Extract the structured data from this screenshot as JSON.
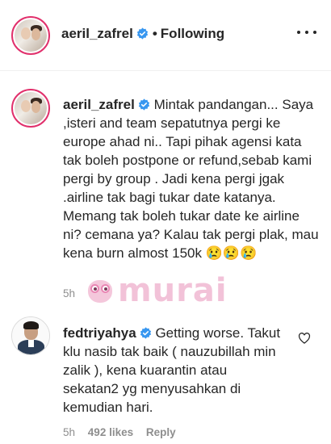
{
  "header": {
    "username": "aeril_zafrel",
    "separator": "•",
    "follow_status": "Following"
  },
  "comments": [
    {
      "username": "aeril_zafrel",
      "text": "Mintak pandangan... Saya ,isteri and team sepatutnya pergi ke europe ahad ni.. Tapi pihak agensi kata tak boleh postpone or refund,sebab kami pergi by group . Jadi kena pergi jgak .airline tak bagi tukar date katanya. Memang tak boleh tukar date ke airline ni? cemana ya? Kalau tak pergi plak, mau kena burn almost 150k 😢😢😢",
      "time": "5h"
    },
    {
      "username": "fedtriyahya",
      "text": "Getting worse. Takut klu nasib tak baik ( nauzubillah min zalik ), kena kuarantin atau sekatan2 yg menyusahkan di kemudian hari.",
      "time": "5h",
      "likes": "492 likes",
      "reply_label": "Reply"
    }
  ],
  "watermark": {
    "text": "murai"
  },
  "icons": {
    "verified": "verified-badge-icon",
    "more": "more-options-icon",
    "like": "heart-icon"
  },
  "colors": {
    "verified_blue": "#3897f0",
    "story_ring": "#e1306c",
    "meta_gray": "#8e8e8e",
    "watermark_pink": "#f2c2d8"
  }
}
